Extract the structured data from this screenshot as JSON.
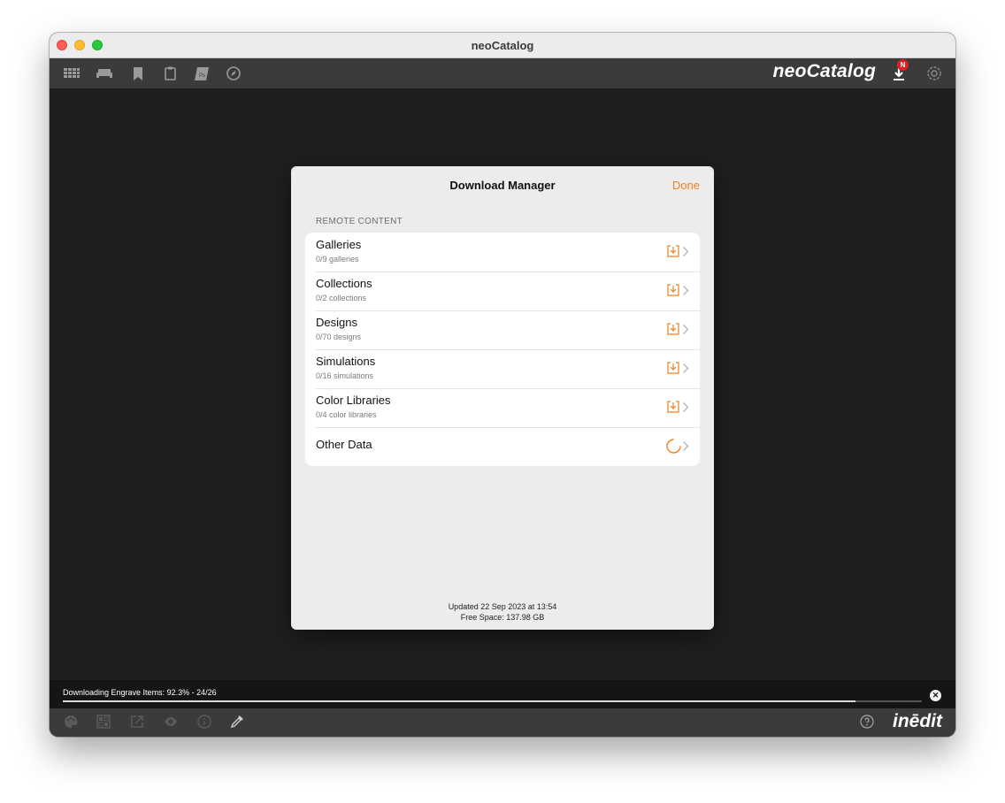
{
  "window": {
    "title": "neoCatalog"
  },
  "toolbar": {
    "icons": [
      "grid-icon",
      "sofa-icon",
      "bookmark-icon",
      "clipboard-icon",
      "photoshop-icon",
      "compass-icon"
    ],
    "brand": "neoCatalog",
    "download_badge": "N"
  },
  "modal": {
    "title": "Download Manager",
    "done_label": "Done",
    "section_header": "REMOTE CONTENT",
    "items": [
      {
        "title": "Galleries",
        "subtitle": "0/9 galleries",
        "status": "download"
      },
      {
        "title": "Collections",
        "subtitle": "0/2 collections",
        "status": "download"
      },
      {
        "title": "Designs",
        "subtitle": "0/70 designs",
        "status": "download"
      },
      {
        "title": "Simulations",
        "subtitle": "0/16 simulations",
        "status": "download"
      },
      {
        "title": "Color Libraries",
        "subtitle": "0/4 color libraries",
        "status": "download"
      },
      {
        "title": "Other Data",
        "subtitle": "",
        "status": "loading"
      }
    ],
    "updated": "Updated 22 Sep 2023 at 13:54",
    "free_space": "Free Space: 137.98 GB"
  },
  "status": {
    "text": "Downloading Engrave Items: 92.3% - 24/26",
    "progress": 0.923
  },
  "bottom": {
    "icons": [
      "palette-icon",
      "pattern-icon",
      "export-icon",
      "eye-icon",
      "info-icon",
      "eyedropper-icon"
    ],
    "brand": "inēdit"
  },
  "colors": {
    "accent": "#f0801e",
    "toolbar": "#3b3b3b",
    "background": "#1f1f1f"
  }
}
